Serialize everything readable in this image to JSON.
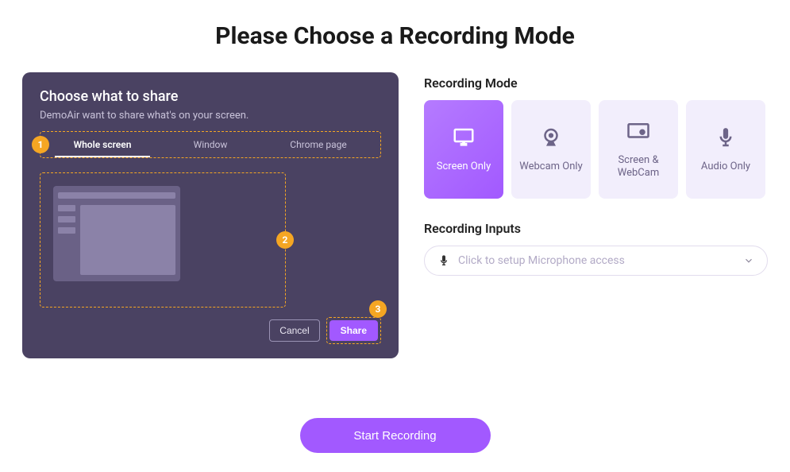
{
  "title": "Please Choose a Recording Mode",
  "share_dialog": {
    "heading": "Choose what to share",
    "subtitle": "DemoAir want to share what's on your screen.",
    "tabs": [
      {
        "label": "Whole screen",
        "active": true
      },
      {
        "label": "Window",
        "active": false
      },
      {
        "label": "Chrome page",
        "active": false
      }
    ],
    "cancel": "Cancel",
    "share": "Share",
    "badges": {
      "tabs": "1",
      "preview": "2",
      "share": "3"
    }
  },
  "modes": {
    "label": "Recording Mode",
    "options": [
      {
        "label": "Screen Only",
        "icon": "monitor",
        "selected": true
      },
      {
        "label": "Webcam Only",
        "icon": "webcam",
        "selected": false
      },
      {
        "label": "Screen & WebCam",
        "icon": "screen-cam",
        "selected": false
      },
      {
        "label": "Audio Only",
        "icon": "mic",
        "selected": false
      }
    ]
  },
  "inputs": {
    "label": "Recording Inputs",
    "placeholder": "Click to setup Microphone access"
  },
  "start_button": "Start Recording"
}
